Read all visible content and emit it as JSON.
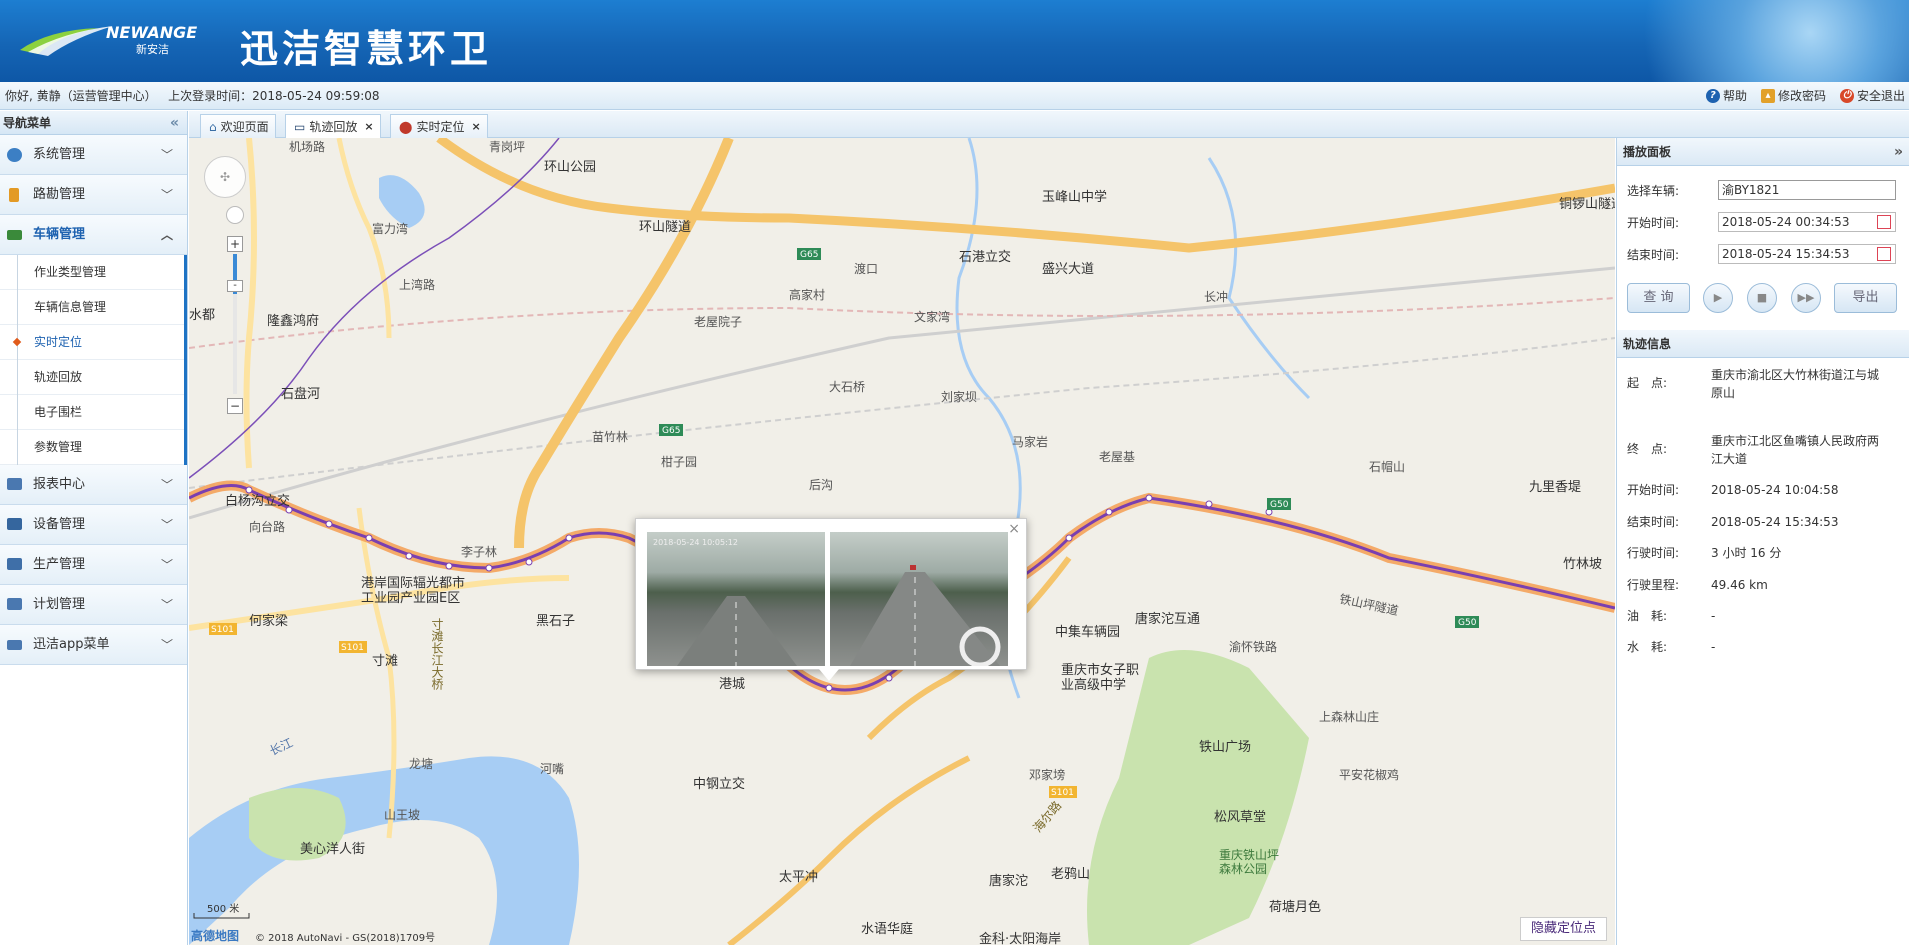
{
  "header": {
    "logo_text": "NEWANGE",
    "logo_cn": "新安洁",
    "title": "迅洁智慧环卫"
  },
  "userbar": {
    "greeting": "你好, 黄静（运营管理中心）",
    "last_login": "上次登录时间：2018-05-24 09:59:08",
    "help": "帮助",
    "change_password": "修改密码",
    "logout": "安全退出"
  },
  "sidebar": {
    "title": "导航菜单",
    "menus": [
      {
        "label": "系统管理",
        "icon": "gear-icon",
        "color": "#3c7fc4"
      },
      {
        "label": "路勘管理",
        "icon": "person-icon",
        "color": "#e39a25"
      },
      {
        "label": "车辆管理",
        "icon": "truck-icon",
        "color": "#3a8a3a"
      },
      {
        "label": "报表中心",
        "icon": "report-icon",
        "color": "#4a78b0"
      },
      {
        "label": "设备管理",
        "icon": "monitor-icon",
        "color": "#35669e"
      },
      {
        "label": "生产管理",
        "icon": "list-icon",
        "color": "#3f6fa8"
      },
      {
        "label": "计划管理",
        "icon": "plan-icon",
        "color": "#4a78b0"
      },
      {
        "label": "迅洁app菜单",
        "icon": "app-icon",
        "color": "#4a78b0"
      }
    ],
    "vehicle_sub": [
      "作业类型管理",
      "车辆信息管理",
      "实时定位",
      "轨迹回放",
      "电子围栏",
      "参数管理"
    ]
  },
  "tabs": [
    {
      "label": "欢迎页面",
      "icon": "home-icon"
    },
    {
      "label": "轨迹回放",
      "icon": "playback-icon"
    },
    {
      "label": "实时定位",
      "icon": "location-pin-icon"
    }
  ],
  "map": {
    "labels": {
      "l1": "青岗坪",
      "l2": "环山公园",
      "l3": "机场路",
      "l4": "富力湾",
      "l5": "上湾路",
      "l6": "隆鑫鸿府",
      "l7": "水都",
      "l8": "石盘河",
      "l9": "白杨沟立交",
      "l10": "向台路",
      "l11": "何家梁",
      "l12": "寸滩",
      "l13": "港岸国际辐光都市工业园产业园E区",
      "l14": "黑石子",
      "l15": "李子林",
      "l16": "玉峰山中学",
      "l17": "石港立交",
      "l18": "盛兴大道",
      "l19": "环山隧道",
      "l20": "渡口",
      "l21": "高家村",
      "l22": "老屋院子",
      "l23": "文家湾",
      "l24": "长冲",
      "l25": "刘家坝",
      "l26": "马家岩",
      "l27": "老屋基",
      "l28": "九里香堤",
      "l29": "竹林坡",
      "l30": "重庆市女子职业高级中学",
      "l31": "中集车辆园",
      "l32": "唐家沱互通",
      "l33": "铁山坪隧道",
      "l34": "铁山广场",
      "l35": "松风草堂",
      "l36": "重庆铁山坪森林公园",
      "l37": "荷塘月色",
      "l38": "平安花椒鸡",
      "l39": "上森林山庄",
      "l40": "中钢立交",
      "l41": "太平冲",
      "l42": "唐家沱",
      "l43": "老鸦山",
      "l44": "美心洋人街",
      "l45": "河嘴",
      "l46": "龙塘",
      "l47": "山王坡",
      "l48": "港城",
      "l49": "水语华庭",
      "l50": "金科·太阳海岸",
      "l51": "寸滩长江大桥",
      "l52": "海尔路",
      "l53": "铜锣山隧道",
      "l54": "渝怀铁路",
      "l55": "长江",
      "l56": "苗竹林",
      "l57": "后沟",
      "l58": "柑子园",
      "l59": "石帽山",
      "l60": "大石桥",
      "l61": "邓家塝"
    },
    "scale": "500 米",
    "copyright": "© 2018 AutoNavi - GS(2018)1709号",
    "brand": "高德地图",
    "hide_button": "隐藏定位点",
    "popup_caption": "2018-05-24 10:05:12"
  },
  "panel": {
    "title": "播放面板",
    "vehicle_label": "选择车辆:",
    "vehicle_value": "渝BY1821",
    "start_label": "开始时间:",
    "start_value": "2018-05-24 00:34:53",
    "end_label": "结束时间:",
    "end_value": "2018-05-24 15:34:53",
    "query": "查 询",
    "export": "导出"
  },
  "track": {
    "title": "轨迹信息",
    "start_point_label": "起　点:",
    "start_point": "重庆市渝北区大竹林街道江与城原山",
    "end_point_label": "终　点:",
    "end_point": "重庆市江北区鱼嘴镇人民政府两江大道",
    "start_time_label": "开始时间:",
    "start_time": "2018-05-24 10:04:58",
    "end_time_label": "结束时间:",
    "end_time": "2018-05-24 15:34:53",
    "duration_label": "行驶时间:",
    "duration": "3 小时 16 分",
    "mileage_label": "行驶里程:",
    "mileage": "49.46 km",
    "fuel_label": "油　耗:",
    "fuel": "-",
    "water_label": "水　耗:",
    "water": "-"
  }
}
